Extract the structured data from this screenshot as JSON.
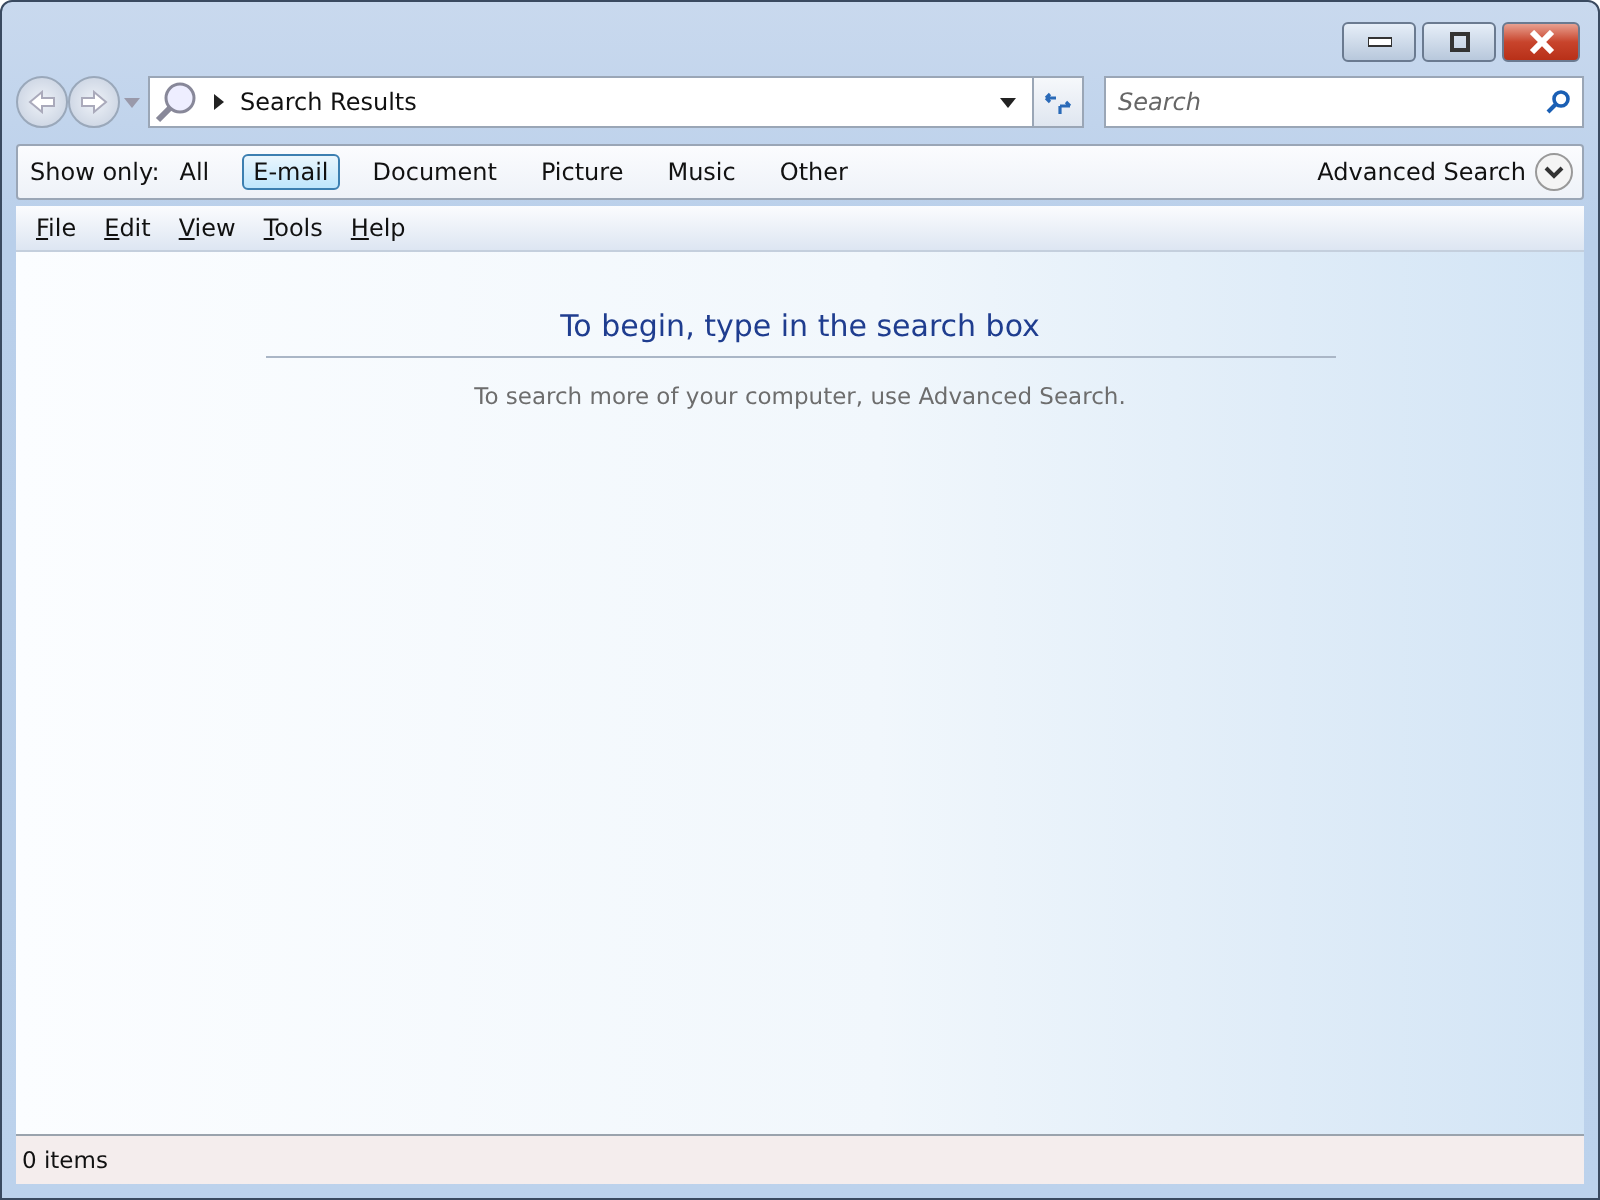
{
  "address_bar": {
    "location": "Search Results"
  },
  "search": {
    "placeholder": "Search"
  },
  "filter_bar": {
    "label": "Show only:",
    "filters": [
      {
        "label": "All",
        "selected": false
      },
      {
        "label": "E-mail",
        "selected": true
      },
      {
        "label": "Document",
        "selected": false
      },
      {
        "label": "Picture",
        "selected": false
      },
      {
        "label": "Music",
        "selected": false
      },
      {
        "label": "Other",
        "selected": false
      }
    ],
    "advanced": "Advanced Search"
  },
  "menu": [
    "File",
    "Edit",
    "View",
    "Tools",
    "Help"
  ],
  "content": {
    "heading": "To begin, type in the search box",
    "hint": "To search more of your computer, use Advanced Search."
  },
  "status_bar": {
    "text": "0 items"
  }
}
